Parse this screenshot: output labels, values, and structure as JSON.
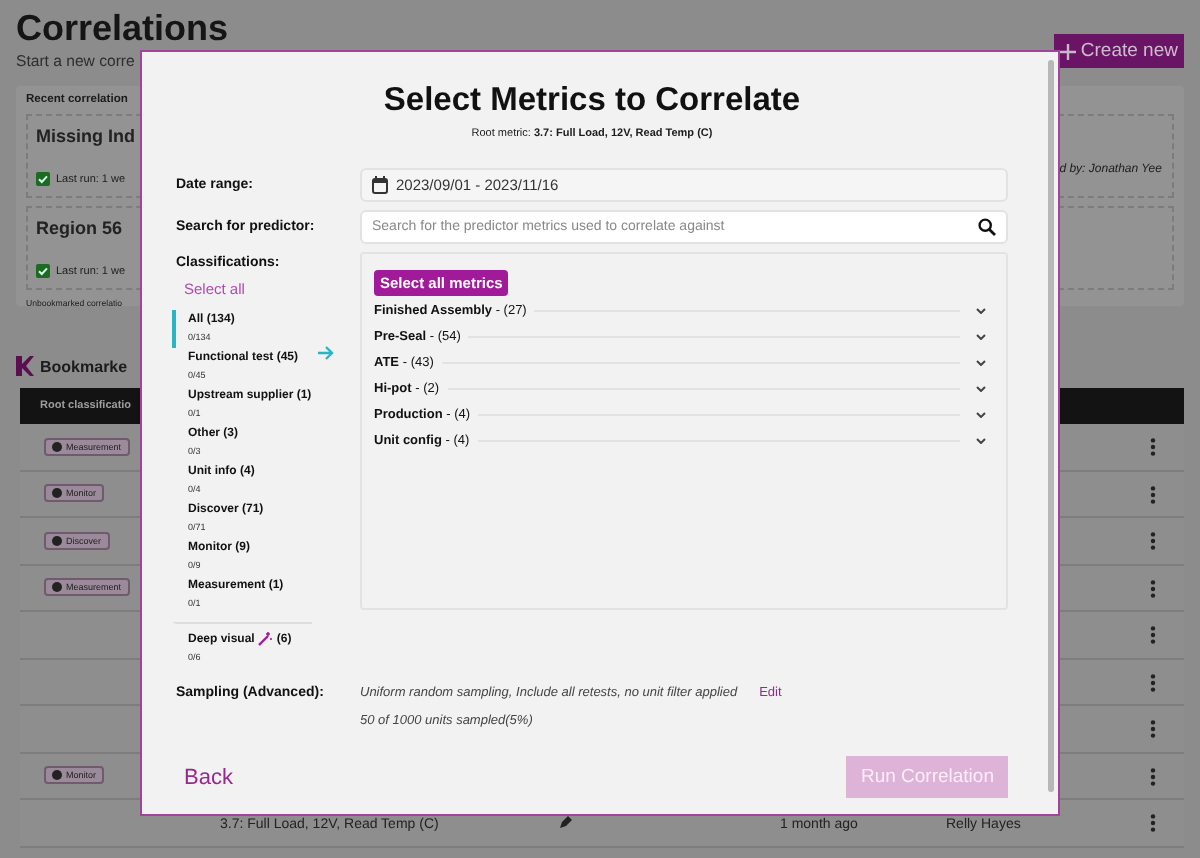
{
  "page": {
    "title": "Correlations",
    "subtitle": "Start a new corre",
    "create_button": "Create new"
  },
  "recent": {
    "title": "Recent correlation",
    "cards": [
      {
        "title": "Missing Ind",
        "last_run": "Last run: 1 we",
        "right_note": "d by: Jonathan Yee"
      },
      {
        "title": "Region 56",
        "last_run": "Last run: 1 we"
      }
    ],
    "footnote": "Unbookmarked correlatio"
  },
  "bookmarked": {
    "title": "Bookmarke",
    "columns": [
      "Root classificatio"
    ],
    "rows": [
      {
        "tag": "Measurement"
      },
      {
        "tag": "Monitor"
      },
      {
        "tag": "Discover"
      },
      {
        "tag": "Measurement"
      },
      {},
      {},
      {},
      {
        "tag": "Monitor"
      },
      {
        "metric": "3.7: Full Load, 12V, Read Temp (C)",
        "time": "1 month ago",
        "owner": "Relly Hayes"
      }
    ]
  },
  "modal": {
    "title": "Select Metrics to Correlate",
    "root_metric": "Root metric: **3.7: Full Load, 12V, Read Temp (C)**",
    "date_label": "Date range:",
    "date_value": "2023/09/01 - 2023/11/16",
    "search_label": "Search for predictor:",
    "search_placeholder": "Search for the predictor metrics used to correlate against",
    "classifications_label": "Classifications:",
    "select_all": "Select all",
    "classifications": [
      {
        "name": "All (134)",
        "count": "0/134",
        "selected": true,
        "wand": false
      },
      {
        "name": "Functional test (45)",
        "count": "0/45",
        "selected": false,
        "wand": false
      },
      {
        "name": "Upstream supplier (1)",
        "count": "0/1",
        "selected": false,
        "wand": false
      },
      {
        "name": "Other (3)",
        "count": "0/3",
        "selected": false,
        "wand": false
      },
      {
        "name": "Unit info (4)",
        "count": "0/4",
        "selected": false,
        "wand": false
      },
      {
        "name": "Discover (71)",
        "count": "0/71",
        "selected": false,
        "wand": false
      },
      {
        "name": "Monitor (9)",
        "count": "0/9",
        "selected": false,
        "wand": false
      },
      {
        "name": "Measurement (1)",
        "count": "0/1",
        "selected": false,
        "wand": false
      },
      {
        "name": "Deep visual",
        "suffix": "(6)",
        "count": "0/6",
        "selected": false,
        "wand": true
      }
    ],
    "select_all_metrics": "Select all metrics",
    "groups": [
      {
        "label": "Finished Assembly",
        "count": "- (27)",
        "expanded": false
      },
      {
        "label": "Pre-Seal",
        "count": "- (54)",
        "expanded": false
      },
      {
        "label": "ATE",
        "count": "- (43)",
        "expanded": false
      },
      {
        "label": "Hi-pot",
        "count": "- (2)",
        "expanded": false
      },
      {
        "label": "Production",
        "count": "- (4)",
        "expanded": false
      },
      {
        "label": "Unit config",
        "count": "- (4)",
        "expanded": false
      }
    ],
    "sampling_label": "Sampling (Advanced):",
    "sampling_text": "Uniform random sampling, Include all retests, no unit filter applied",
    "sampling_edit": "Edit",
    "sampled": "50 of 1000 units sampled(5%)",
    "back": "Back",
    "run": {
      "label": "Run Correlation",
      "disabled": true
    }
  }
}
